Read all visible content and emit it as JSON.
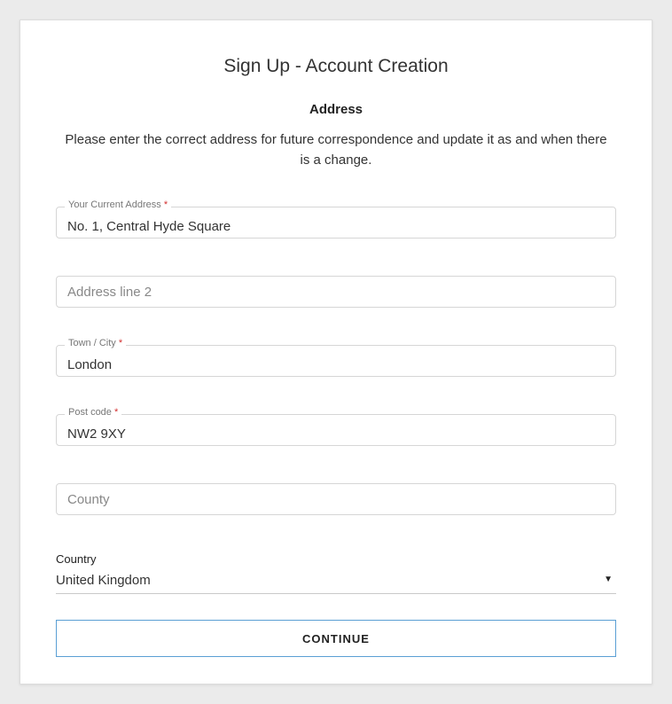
{
  "title": "Sign Up - Account Creation",
  "section_heading": "Address",
  "description": "Please enter the correct address for future correspondence and update it as and when there is a change.",
  "fields": {
    "address1": {
      "label": "Your Current Address",
      "value": "No. 1, Central Hyde Square",
      "required": true
    },
    "address2": {
      "placeholder": "Address line 2",
      "value": ""
    },
    "town": {
      "label": "Town / City",
      "value": "London",
      "required": true
    },
    "postcode": {
      "label": "Post code",
      "value": "NW2 9XY",
      "required": true
    },
    "county": {
      "placeholder": "County",
      "value": ""
    }
  },
  "country": {
    "label": "Country",
    "value": "United Kingdom"
  },
  "continue_label": "CONTINUE",
  "required_marker": "*"
}
